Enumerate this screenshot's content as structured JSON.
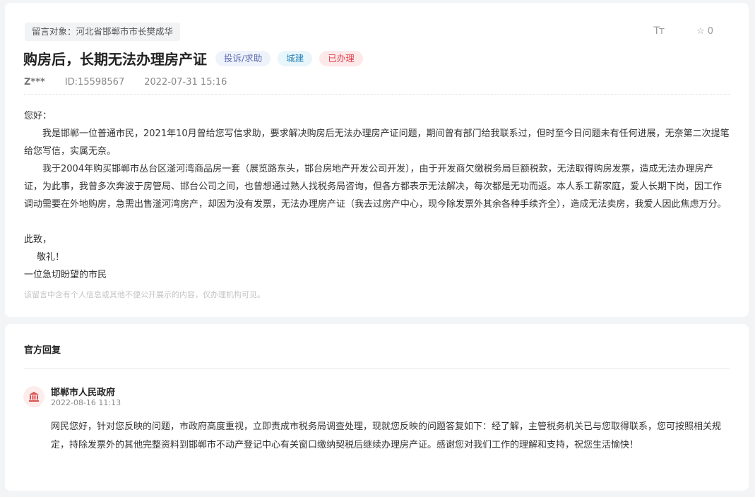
{
  "message": {
    "target": "留言对象：河北省邯郸市市长樊成华",
    "font_tool_label": "Tт",
    "favorite": {
      "icon": "star-outline-icon",
      "count": "0"
    },
    "title": "购房后，长期无法办理房产证",
    "tags": {
      "category": "投诉/求助",
      "area": "城建",
      "status": "已办理"
    },
    "author": "Z***",
    "id": "ID:15598567",
    "time": "2022-07-31 15:16",
    "greeting": "您好：",
    "paragraph1": "我是邯郸一位普通市民，2021年10月曾给您写信求助，要求解决购房后无法办理房产证问题，期间曾有部门给我联系过，但时至今日问题未有任何进展，无奈第二次提笔给您写信，实属无奈。",
    "paragraph2": "我于2004年购买邯郸市丛台区滏河湾商品房一套（展览路东头，邯台房地产开发公司开发），由于开发商欠缴税务局巨额税款，无法取得购房发票，造成无法办理房产证，为此事，我曾多次奔波于房管局、邯台公司之间，也曾想通过熟人找税务局咨询，但各方都表示无法解决，每次都是无功而返。本人系工薪家庭，爱人长期下岗，因工作调动需要在外地购房，急需出售滏河湾房产，却因为没有发票，无法办理房产证（我去过房产中心，现今除发票外其余各种手续齐全），造成无法卖房，我爱人因此焦虑万分。",
    "closing1": "此致，",
    "closing2": "敬礼！",
    "signature": "一位急切盼望的市民",
    "privacy_note": "该留言中含有个人信息或其他不便公开展示的内容，仅办理机构可见。"
  },
  "reply": {
    "section_title": "官方回复",
    "org_icon": "government-building-icon",
    "org_name": "邯郸市人民政府",
    "time": "2022-08-16 11:13",
    "content": "网民您好，针对您反映的问题，市政府高度重视，立即责成市税务局调查处理，现就您反映的问题答复如下：经了解，主管税务机关已与您取得联系，您可按照相关规定，持除发票外的其他完整资料到邯郸市不动产登记中心有关窗口缴纳契税后继续办理房产证。感谢您对我们工作的理解和支持，祝您生活愉快！"
  },
  "colors": {
    "status_red": "#e0424d",
    "area_blue": "#2e86b8",
    "category_blue": "#5c6bae",
    "org_icon_red": "#d9534f"
  }
}
